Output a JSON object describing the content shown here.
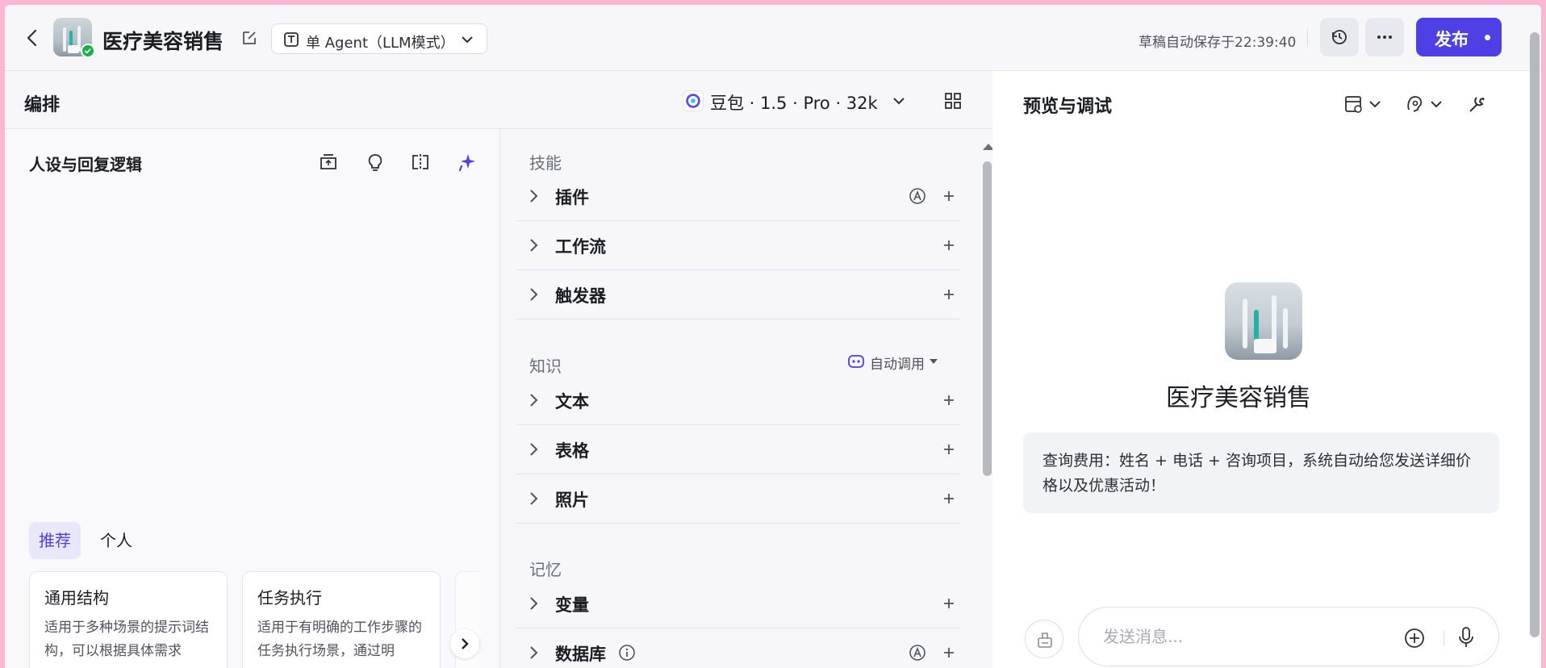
{
  "header": {
    "app_name": "医疗美容销售",
    "mode": "单 Agent（LLM模式）",
    "autosave": "草稿自动保存于22:39:40",
    "publish_label": "发布"
  },
  "editor": {
    "title": "编排",
    "model": "豆包 · 1.5 · Pro · 32k"
  },
  "persona": {
    "title": "人设与回复逻辑",
    "tabs": [
      {
        "label": "推荐",
        "active": true
      },
      {
        "label": "个人",
        "active": false
      }
    ],
    "templates": [
      {
        "title": "通用结构",
        "desc": "适用于多种场景的提示词结构，可以根据具体需求"
      },
      {
        "title": "任务执行",
        "desc": "适用于有明确的工作步骤的任务执行场景，通过明"
      }
    ]
  },
  "skills": {
    "group_skill": "技能",
    "plugin": "插件",
    "workflow": "工作流",
    "trigger": "触发器",
    "group_knowledge": "知识",
    "auto_call": "自动调用",
    "text": "文本",
    "table": "表格",
    "photo": "照片",
    "group_memory": "记忆",
    "variable": "变量",
    "database": "数据库"
  },
  "preview": {
    "title": "预览与调试",
    "bot_name": "医疗美容销售",
    "opener": "查询费用：姓名 + 电话 + 咨询项目，系统自动给您发送详细价格以及优惠活动！",
    "input_placeholder": "发送消息..."
  },
  "colors": {
    "accent": "#4e40e5",
    "verified": "#19b14a"
  }
}
